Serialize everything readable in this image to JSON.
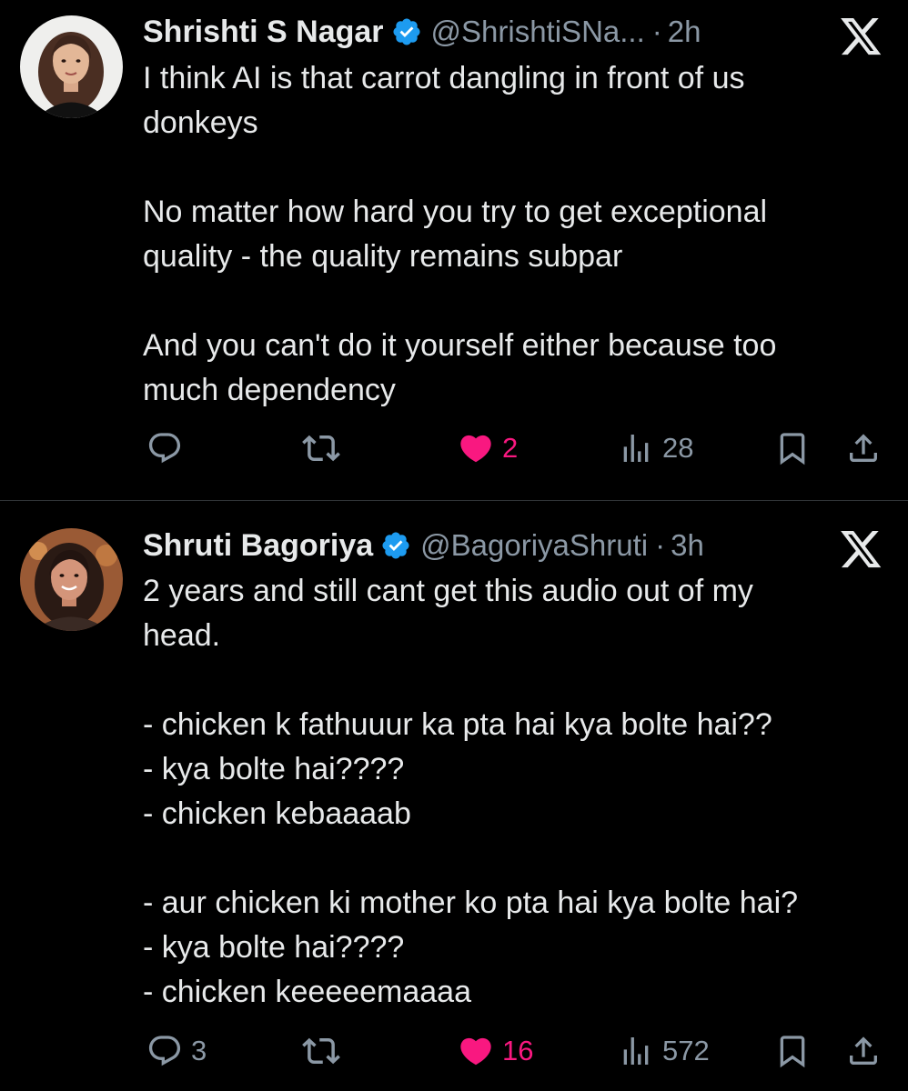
{
  "tweets": [
    {
      "author_name": "Shrishti S Nagar",
      "handle": "@ShrishtiSNa...",
      "separator": "·",
      "time": "2h",
      "body_lines": [
        "I think AI is that carrot dangling in front of us",
        "donkeys",
        "",
        "No matter how hard you try to get exceptional",
        "quality - the quality remains subpar",
        "",
        "And you can't do it yourself either because too",
        "much dependency"
      ],
      "reply_count": "",
      "retweet_count": "",
      "like_count": "2",
      "view_count": "28",
      "liked": true
    },
    {
      "author_name": "Shruti Bagoriya",
      "handle": "@BagoriyaShruti",
      "separator": "·",
      "time": "3h",
      "body_lines": [
        "2 years and still cant get this audio out of my",
        "head.",
        "",
        "- chicken k fathuuur ka pta hai kya bolte hai??",
        "- kya bolte hai????",
        "- chicken kebaaaab",
        "",
        "- aur chicken ki mother ko pta hai kya bolte hai?",
        "- kya bolte hai????",
        "- chicken keeeeemaaaa"
      ],
      "reply_count": "3",
      "retweet_count": "",
      "like_count": "16",
      "view_count": "572",
      "liked": true
    }
  ],
  "icons": {
    "verified": "verified-badge-icon",
    "platform": "x-logo-icon",
    "reply": "reply-icon",
    "retweet": "retweet-icon",
    "like": "heart-icon",
    "views": "views-icon",
    "bookmark": "bookmark-icon",
    "share": "share-icon"
  },
  "colors": {
    "background": "#000000",
    "text_primary": "#e7e9ea",
    "text_secondary": "#8b98a5",
    "like_active": "#f91880",
    "verified": "#1d9bf0",
    "divider": "#2f3336"
  }
}
